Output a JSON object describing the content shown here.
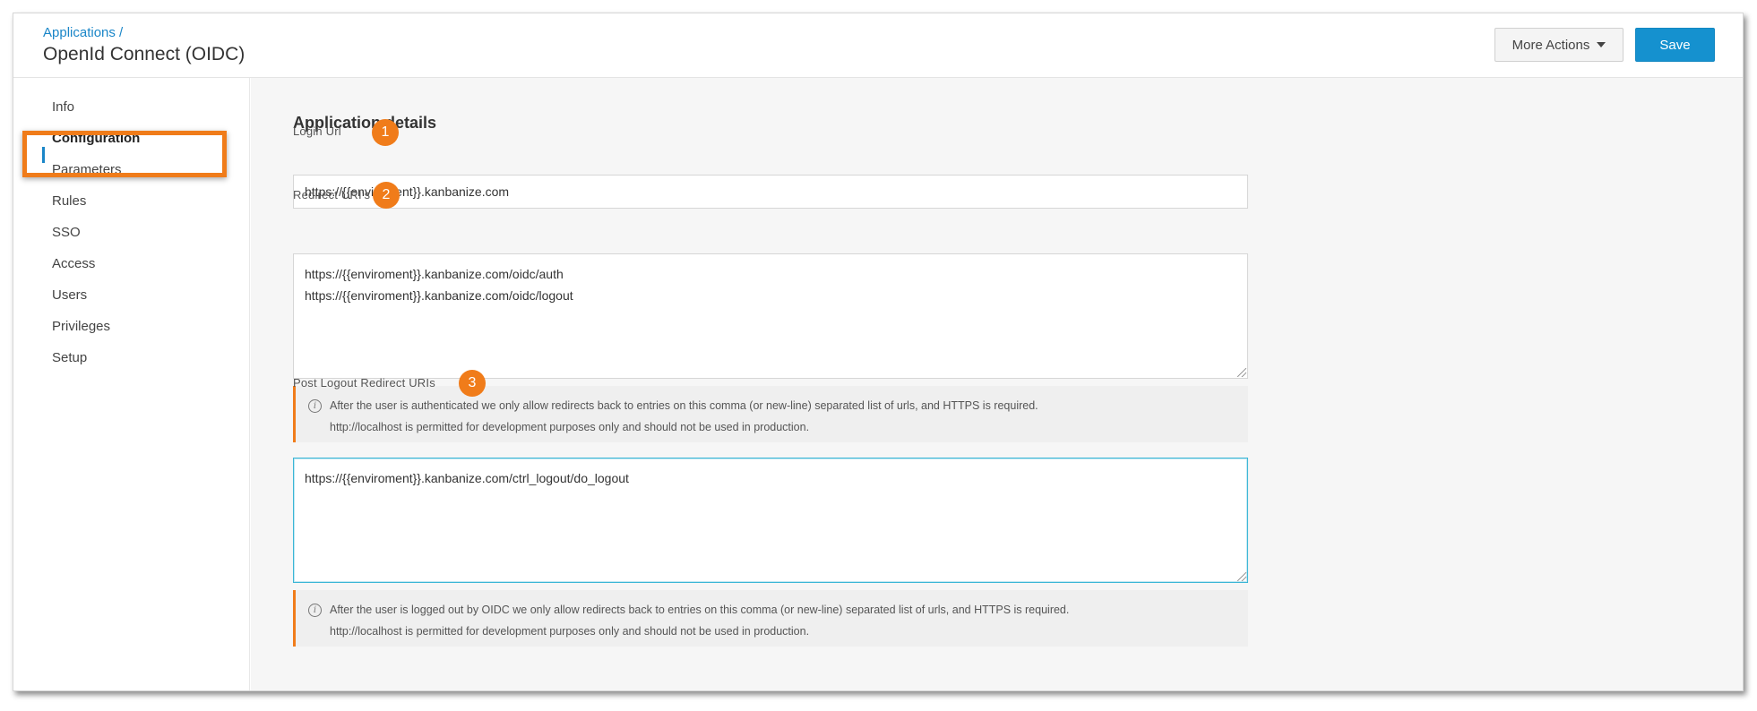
{
  "header": {
    "breadcrumb": "Applications /",
    "title": "OpenId Connect (OIDC)",
    "more_actions_label": "More Actions",
    "save_label": "Save"
  },
  "sidebar": {
    "items": [
      {
        "label": "Info"
      },
      {
        "label": "Configuration",
        "active": true
      },
      {
        "label": "Parameters"
      },
      {
        "label": "Rules"
      },
      {
        "label": "SSO"
      },
      {
        "label": "Access"
      },
      {
        "label": "Users"
      },
      {
        "label": "Privileges"
      },
      {
        "label": "Setup"
      }
    ]
  },
  "main": {
    "section_title": "Application details",
    "login_url": {
      "label": "Login Url",
      "badge": "1",
      "value": "https://{{enviroment}}.kanbanize.com"
    },
    "redirect_uris": {
      "label": "Redirect URI's",
      "badge": "2",
      "value": "https://{{enviroment}}.kanbanize.com/oidc/auth\nhttps://{{enviroment}}.kanbanize.com/oidc/logout",
      "note_line1": "After the user is authenticated we only allow redirects back to entries on this comma (or new-line) separated list of urls, and HTTPS is required.",
      "note_line2": "http://localhost is permitted for development purposes only and should not be used in production."
    },
    "post_logout_uris": {
      "label": "Post Logout Redirect URIs",
      "badge": "3",
      "value": "https://{{enviroment}}.kanbanize.com/ctrl_logout/do_logout",
      "note_line1": "After the user is logged out by OIDC we only allow redirects back to entries on this comma (or new-line) separated list of urls, and HTTPS is required.",
      "note_line2": "http://localhost is permitted for development purposes only and should not be used in production."
    }
  },
  "colors": {
    "accent_blue": "#1591cf",
    "highlight_orange": "#f07c1a"
  }
}
